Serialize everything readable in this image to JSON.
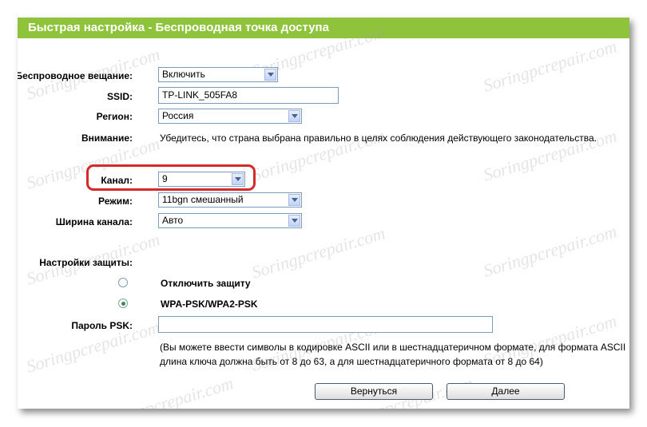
{
  "header": {
    "title": "Быстрая настройка - Беспроводная точка доступа"
  },
  "watermark": "Soringpcrepair.com",
  "form": {
    "broadcast": {
      "label": "Беспроводное вещание:",
      "value": "Включить"
    },
    "ssid": {
      "label": "SSID:",
      "value": "TP-LINK_505FA8"
    },
    "region": {
      "label": "Регион:",
      "value": "Россия"
    },
    "warning": {
      "label": "Внимание:",
      "text": "Убедитесь, что страна выбрана правильно в целях соблюдения действующего законодательства."
    },
    "channel": {
      "label": "Канал:",
      "value": "9"
    },
    "mode": {
      "label": "Режим:",
      "value": "11bgn смешанный"
    },
    "width": {
      "label": "Ширина канала:",
      "value": "Авто"
    },
    "security": {
      "label": "Настройки защиты:",
      "disable_label": "Отключить защиту",
      "wpa_label": "WPA-PSK/WPA2-PSK"
    },
    "psk": {
      "label": "Пароль PSK:",
      "value": "",
      "hint_line1": "(Вы можете ввести символы в кодировке ASCII или в шестнадцатеричном формате, для формата ASCII",
      "hint_line2": "длина ключа должна быть от 8 до 63, а для шестнадцатеричного формата от 8 до 64)"
    }
  },
  "buttons": {
    "back": "Вернуться",
    "next": "Далее"
  },
  "colors": {
    "header_bg": "#8fc33c",
    "highlight": "#d42a2a"
  }
}
